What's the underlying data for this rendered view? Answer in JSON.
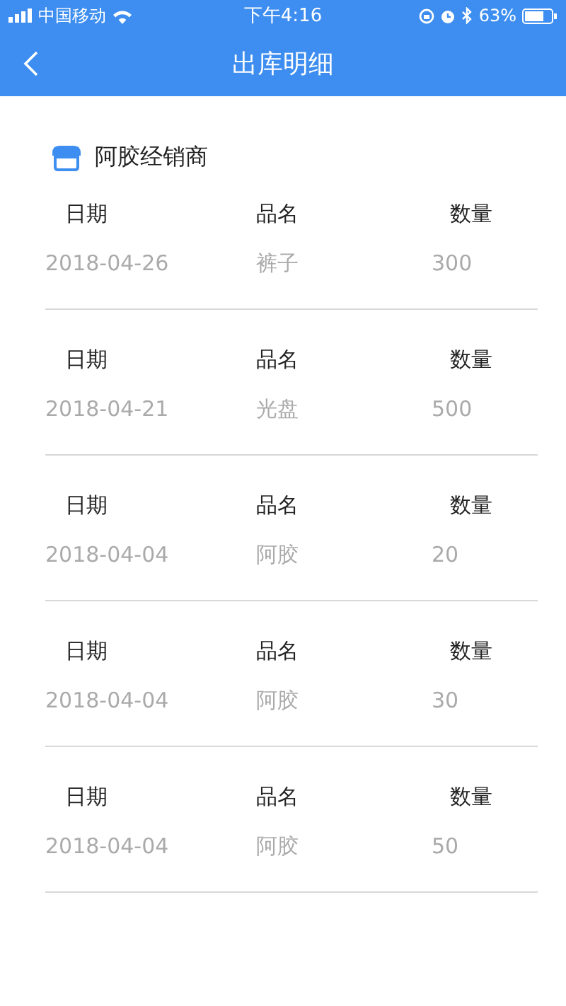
{
  "status_bar": {
    "carrier": "中国移动",
    "time": "下午4:16",
    "battery": "63%"
  },
  "header": {
    "title": "出库明细"
  },
  "shop": {
    "name": "阿胶经销商"
  },
  "records": [
    {
      "labels": [
        "日期",
        "品名",
        "数量"
      ],
      "date": "2018-04-26",
      "product": "裤子",
      "quantity": "300"
    },
    {
      "labels": [
        "日期",
        "品名",
        "数量"
      ],
      "date": "2018-04-21",
      "product": "光盘",
      "quantity": "500"
    },
    {
      "labels": [
        "日期",
        "品名",
        "数量"
      ],
      "date": "2018-04-04",
      "product": "阿胶",
      "quantity": "20"
    },
    {
      "labels": [
        "日期",
        "品名",
        "数量"
      ],
      "date": "2018-04-04",
      "product": "阿胶",
      "quantity": "30"
    },
    {
      "labels": [
        "日期",
        "品名",
        "数量"
      ],
      "date": "2018-04-04",
      "product": "阿胶",
      "quantity": "50"
    }
  ]
}
